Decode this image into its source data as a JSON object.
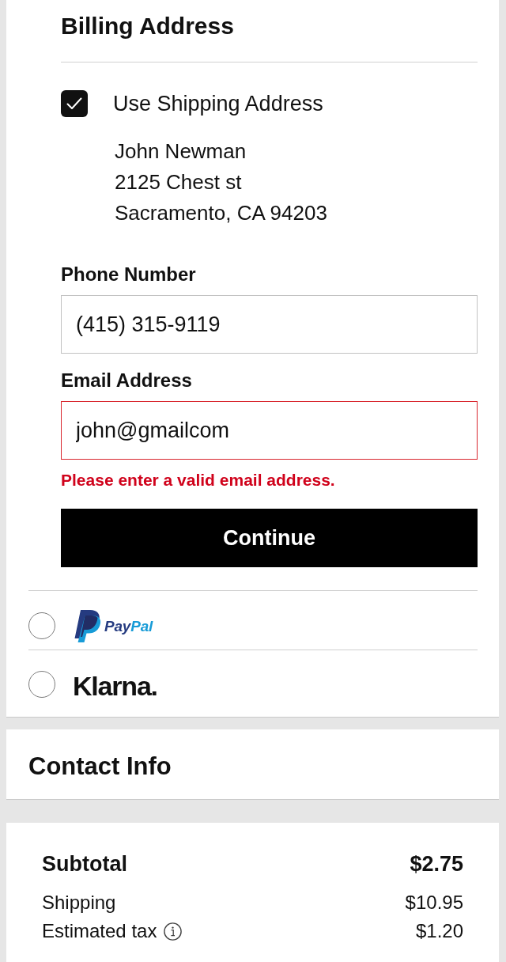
{
  "billing": {
    "title": "Billing Address",
    "use_shipping": {
      "label": "Use Shipping Address",
      "checked": true
    },
    "address_lines": [
      "John Newman",
      "2125 Chest st",
      "Sacramento, CA 94203"
    ],
    "fields": [
      {
        "label": "Phone Number",
        "value": "(415) 315-9119",
        "invalid": false
      },
      {
        "label": "Email Address",
        "value": "john@gmailcom",
        "invalid": true,
        "error": "Please enter a valid email address."
      }
    ],
    "continue_button": "Continue"
  },
  "payment_options": [
    {
      "kind": "paypal",
      "wordmark": [
        "Pay",
        "Pal"
      ],
      "selected": false
    },
    {
      "kind": "klarna",
      "wordmark": [
        "Klarna."
      ],
      "selected": false
    }
  ],
  "contact": {
    "title": "Contact Info"
  },
  "summary": {
    "rows": [
      {
        "kind": "total",
        "label": "Subtotal",
        "value": "$2.75"
      },
      {
        "kind": "line",
        "label": "Shipping",
        "value": "$10.95"
      },
      {
        "kind": "line",
        "label": "Estimated tax",
        "value": "$1.20",
        "info": true
      }
    ]
  }
}
